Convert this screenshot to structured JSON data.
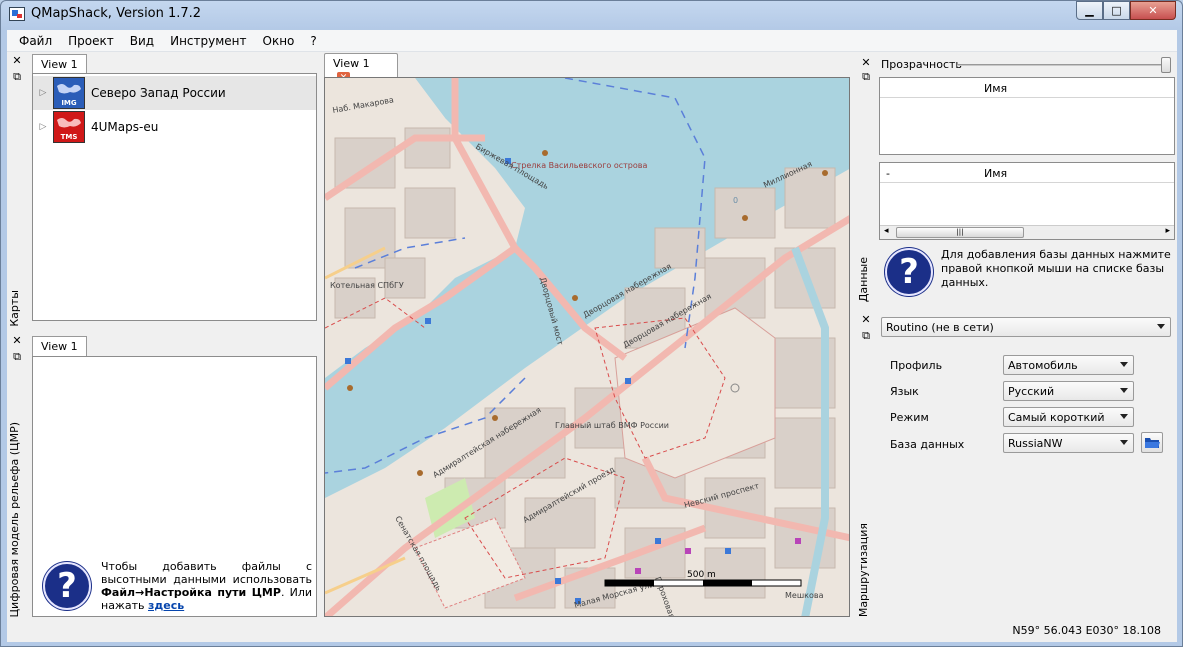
{
  "title": "QMapShack, Version 1.7.2",
  "window_buttons": {
    "minimize": "▁",
    "maximize": "□",
    "close": "✕"
  },
  "menu": [
    "Файл",
    "Проект",
    "Вид",
    "Инструмент",
    "Окно",
    "?"
  ],
  "maps_dock": {
    "title": "Карты",
    "tab": "View 1",
    "items": [
      {
        "name": "Северо Запад России",
        "badge": "IMG",
        "icon": "img-map-icon"
      },
      {
        "name": "4UMaps-eu",
        "badge": "TMS",
        "icon": "tms-map-icon"
      }
    ]
  },
  "dem_dock": {
    "title": "Цифровая модель рельефа (ЦМР)",
    "tab": "View 1",
    "help_part1": "Чтобы добавить файлы с высотными данными использовать ",
    "help_bold": "Файл→Настройка пути ЦМР",
    "help_part2": ". Или нажать ",
    "help_link": "здесь"
  },
  "map_view": {
    "tab": "View 1",
    "scale_label": "500 m",
    "labels": {
      "strelka": "Стрелка Васильевского острова",
      "birzh": "Биржевая площадь",
      "dvortsovy": "Дворцовый мост",
      "dvortsovaya_nab": "Дворцовая набережная",
      "admiralt_nab": "Адмиралтейская набережная",
      "kot": "Котельная СПбГУ",
      "shtab": "Главный штаб ВМФ России",
      "nevsky": "Невский проспект",
      "senatskaya": "Сенатская площадь",
      "makarova": "Наб. Макарова",
      "pirog": "Дворцовая набережная",
      "malaya": "Малая Морская улица",
      "admiralt_pr": "Адмиралтейский проезд",
      "mesh": "Мешкова",
      "gor": "Гороховая",
      "millionnaya": "Миллионная",
      "zero": "0"
    }
  },
  "data_dock": {
    "title": "Данные",
    "opacity_label": "Прозрачность",
    "opacity": 1.0,
    "table1_header": "Имя",
    "table2_minus": "-",
    "table2_header": "Имя",
    "scroll_grip": "|||",
    "help": "Для добавления базы данных нажмите правой кнопкой мыши на списке базы данных."
  },
  "routing_dock": {
    "title": "Маршрутизация",
    "engine": "Routino (не в сети)",
    "fields": [
      {
        "label": "Профиль",
        "value": "Автомобиль"
      },
      {
        "label": "Язык",
        "value": "Русский"
      },
      {
        "label": "Режим",
        "value": "Самый короткий"
      },
      {
        "label": "База данных",
        "value": "RussiaNW"
      }
    ]
  },
  "status": {
    "coords": "N59° 56.043 E030° 18.108"
  }
}
